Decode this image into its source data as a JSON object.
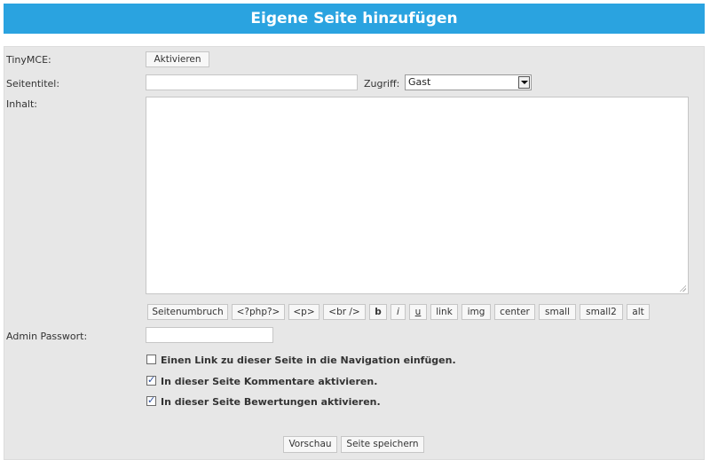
{
  "header": {
    "title": "Eigene Seite hinzufügen"
  },
  "form": {
    "tinymce_label": "TinyMCE:",
    "tinymce_button": "Aktivieren",
    "title_label": "Seitentitel:",
    "title_value": "",
    "access_label": "Zugriff:",
    "access_selected": "Gast",
    "content_label": "Inhalt:",
    "content_value": "",
    "toolbar": [
      "Seitenumbruch",
      "<?php?>",
      "<p>",
      "<br />",
      "b",
      "i",
      "u",
      "link",
      "img",
      "center",
      "small",
      "small2",
      "alt"
    ],
    "admin_password_label": "Admin Passwort:",
    "admin_password_value": "",
    "checkboxes": [
      {
        "label": "Einen Link zu dieser Seite in die Navigation einfügen.",
        "checked": false
      },
      {
        "label": "In dieser Seite Kommentare aktivieren.",
        "checked": true
      },
      {
        "label": "In dieser Seite Bewertungen aktivieren.",
        "checked": true
      }
    ],
    "preview_button": "Vorschau",
    "save_button": "Seite speichern"
  }
}
